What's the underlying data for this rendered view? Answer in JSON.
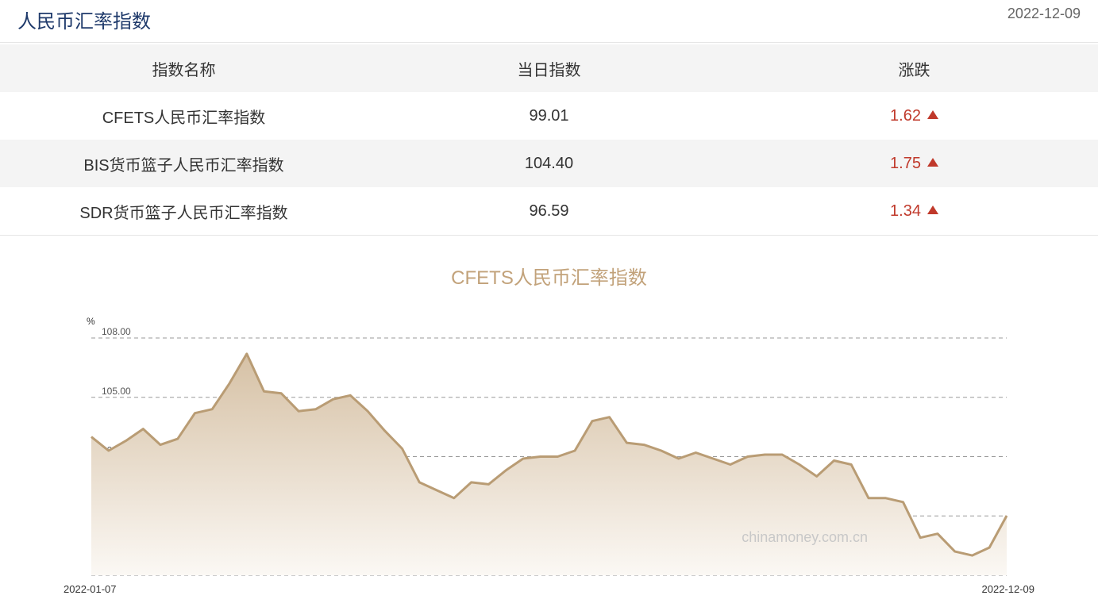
{
  "header": {
    "title": "人民币汇率指数",
    "date": "2022-12-09"
  },
  "table": {
    "columns": [
      "指数名称",
      "当日指数",
      "涨跌"
    ],
    "rows": [
      {
        "name": "CFETS人民币汇率指数",
        "value": "99.01",
        "change": "1.62"
      },
      {
        "name": "BIS货币篮子人民币汇率指数",
        "value": "104.40",
        "change": "1.75"
      },
      {
        "name": "SDR货币篮子人民币汇率指数",
        "value": "96.59",
        "change": "1.34"
      }
    ]
  },
  "chart_data": {
    "type": "area",
    "title": "CFETS人民币汇率指数",
    "ylabel": "%",
    "ylim": [
      96,
      108
    ],
    "yticks": [
      "108.00",
      "105.00",
      "102.00",
      "99.00",
      "96.00"
    ],
    "x_start_label": "2022-01-07",
    "x_end_label": "2022-12-09",
    "watermark": "chinamoney.com.cn",
    "values": [
      103.0,
      102.3,
      102.8,
      103.4,
      102.6,
      102.9,
      104.2,
      104.4,
      105.7,
      107.2,
      105.3,
      105.2,
      104.3,
      104.4,
      104.9,
      105.1,
      104.3,
      103.3,
      102.4,
      100.7,
      100.3,
      99.9,
      100.7,
      100.6,
      101.3,
      101.9,
      102.0,
      102.0,
      102.3,
      103.8,
      104.0,
      102.7,
      102.6,
      102.3,
      101.9,
      102.2,
      101.9,
      101.6,
      102.0,
      102.1,
      102.1,
      101.6,
      101.0,
      101.8,
      101.6,
      99.9,
      99.9,
      99.7,
      97.9,
      98.1,
      97.2,
      97.0,
      97.4,
      99.01
    ],
    "colors": {
      "line": "#b99c74",
      "fill_top": "#d6c1a5",
      "fill_bottom": "#fbf8f4",
      "grid": "#999999"
    }
  }
}
